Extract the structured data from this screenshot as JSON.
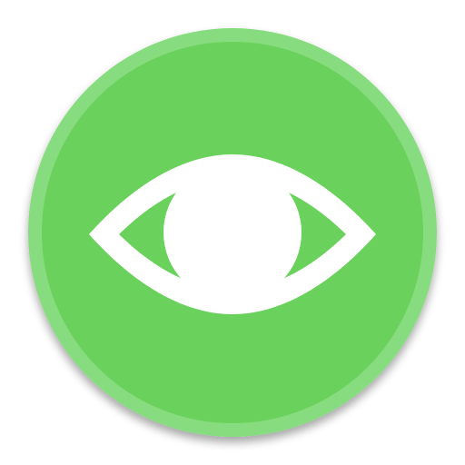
{
  "icon": {
    "name": "eye-icon",
    "outer_ring_color": "#86dc7e",
    "face_color": "#6bd15b",
    "glyph_color": "#ffffff",
    "shadow_color": "#8f8f8f"
  }
}
